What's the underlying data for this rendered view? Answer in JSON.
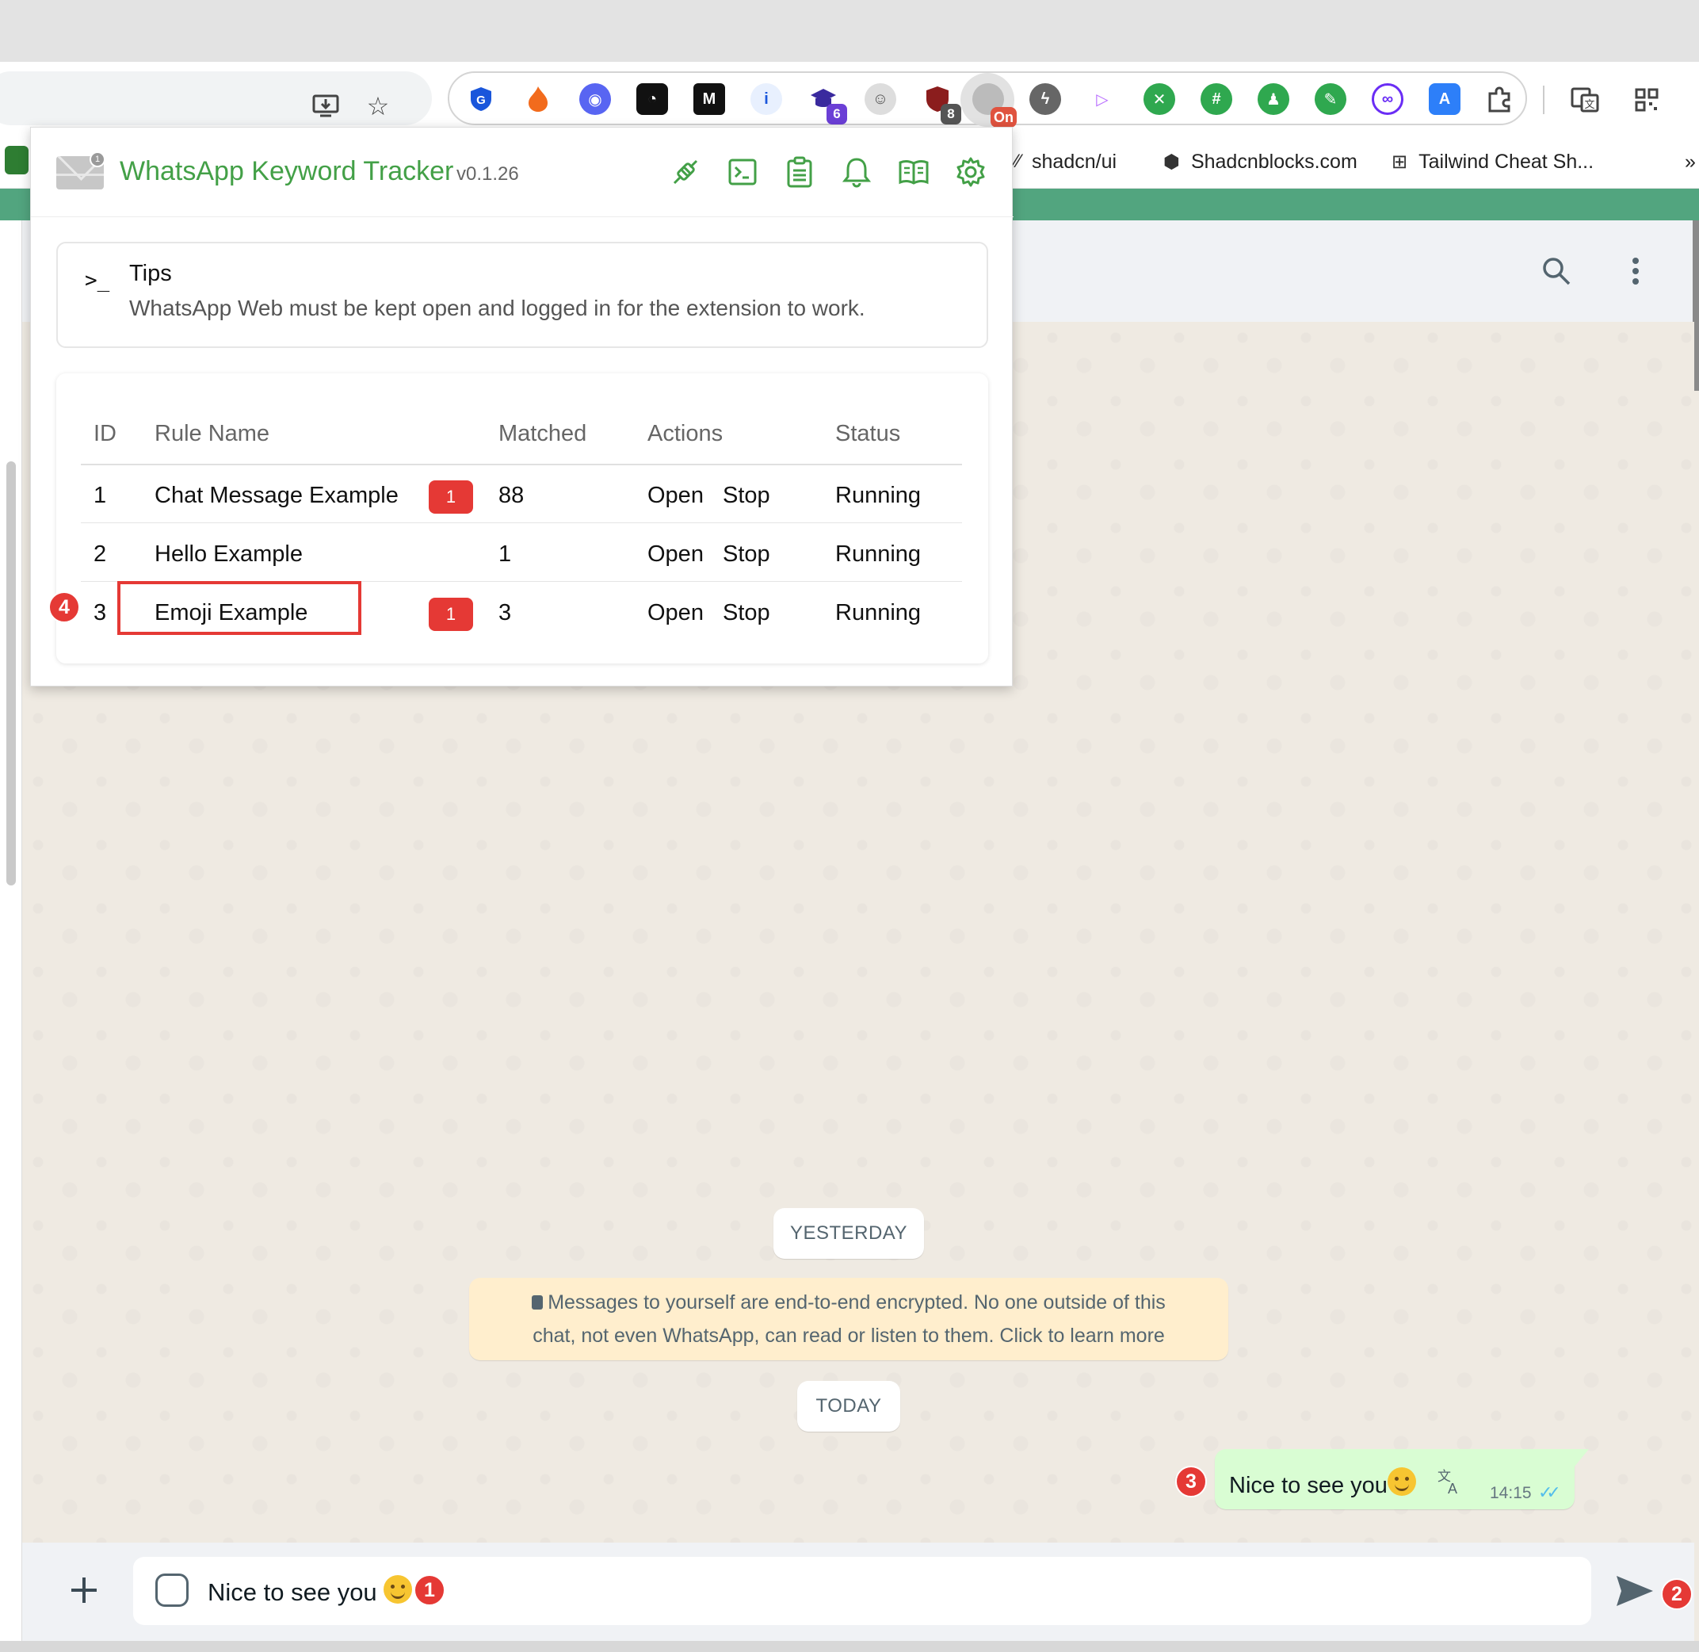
{
  "browser": {
    "bookmarks": [
      "shadcn/ui",
      "Shadcnblocks.com",
      "Tailwind Cheat Sh..."
    ],
    "extension_badges": {
      "ext_6": "6",
      "ext_8": "8",
      "ext_on": "On"
    }
  },
  "popup": {
    "title": "WhatsApp Keyword Tracker",
    "version": "v0.1.26",
    "envelope_badge": "1",
    "tips": {
      "prompt": ">_",
      "title": "Tips",
      "text": "WhatsApp Web must be kept open and logged in for the extension to work."
    },
    "table": {
      "headers": [
        "ID",
        "Rule Name",
        "Matched",
        "Actions",
        "Status"
      ],
      "rows": [
        {
          "id": "1",
          "name": "Chat Message Example",
          "badge": "1",
          "matched": "88",
          "open": "Open",
          "stop": "Stop",
          "status": "Running"
        },
        {
          "id": "2",
          "name": "Hello Example",
          "badge": "",
          "matched": "1",
          "open": "Open",
          "stop": "Stop",
          "status": "Running"
        },
        {
          "id": "3",
          "name": "Emoji Example",
          "badge": "1",
          "matched": "3",
          "open": "Open",
          "stop": "Stop",
          "status": "Running"
        }
      ]
    }
  },
  "chat": {
    "date_yesterday": "YESTERDAY",
    "encryption_line1": "Messages to yourself are end-to-end encrypted. No one outside of this",
    "encryption_line2": "chat, not even WhatsApp, can read or listen to them. Click to learn more",
    "date_today": "TODAY",
    "message": {
      "text": "Nice to see you",
      "time": "14:15",
      "ticks": "✓✓"
    },
    "compose_text": "Nice to see you"
  },
  "steps": {
    "s1": "1",
    "s2": "2",
    "s3": "3",
    "s4": "4"
  },
  "colors": {
    "brand_green": "#43a047",
    "header_green": "#52a57f",
    "badge_red": "#e53935",
    "bubble_green": "#d9fdd3"
  }
}
